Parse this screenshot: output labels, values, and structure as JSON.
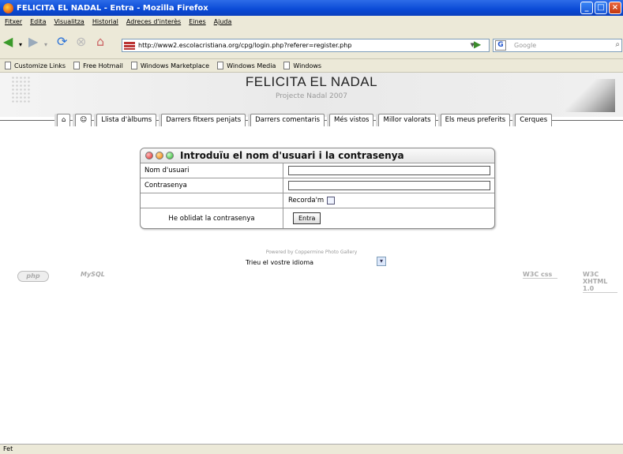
{
  "window": {
    "title": "FELICITA EL NADAL - Entra - Mozilla Firefox"
  },
  "menu": [
    "Fitxer",
    "Edita",
    "Visualitza",
    "Historial",
    "Adreces d'interès",
    "Eines",
    "Ajuda"
  ],
  "navbar": {
    "url": "http://www2.escolacristiana.org/cpg/login.php?referer=register.php",
    "search_placeholder": "Google"
  },
  "bookmarks": [
    "Customize Links",
    "Free Hotmail",
    "Windows Marketplace",
    "Windows Media",
    "Windows"
  ],
  "site": {
    "title": "FELICITA EL NADAL",
    "subtitle": "Projecte Nadal 2007"
  },
  "tabs": [
    "⌂",
    "☺",
    "Llista d'àlbums",
    "Darrers fitxers penjats",
    "Darrers comentaris",
    "Més vistos",
    "Millor valorats",
    "Els meus preferits",
    "Cerques"
  ],
  "login": {
    "title": "Introduïu el nom d'usuari i la contrasenya",
    "username_label": "Nom d'usuari",
    "password_label": "Contrasenya",
    "remember_label": "Recorda'm",
    "forgot_label": "He oblidat la contrasenya",
    "submit_label": "Entra"
  },
  "footer": {
    "powered": "Powered by Coppermine Photo Gallery",
    "language_label": "Trieu el vostre idioma",
    "badges": [
      "php",
      "MySQL",
      "W3C css",
      "W3C XHTML 1.0"
    ]
  },
  "status": "Fet"
}
